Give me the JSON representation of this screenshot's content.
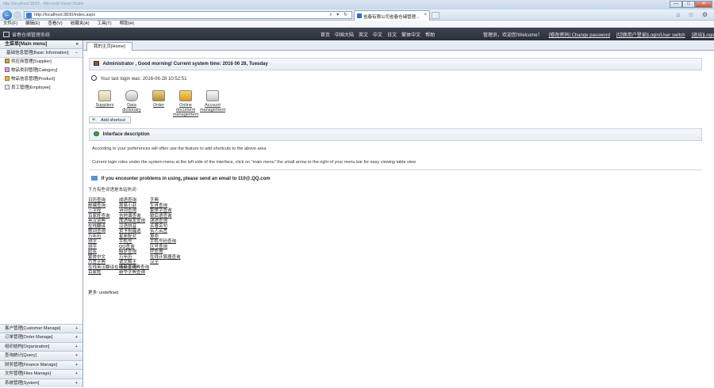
{
  "browser": {
    "url": "http://localhost:3830/index.aspx",
    "tab_title": "省春有限公司省春仓储管理...",
    "tab_close": "×",
    "address_controls": "⌕ ▾ ↻",
    "tools": "⌂ ☆ ⚙",
    "win_min": "—",
    "win_max": "□",
    "win_close": "✕"
  },
  "menubar": [
    "文件(F)",
    "编辑(E)",
    "查看(V)",
    "收藏夹(A)",
    "工具(T)",
    "帮助(H)"
  ],
  "app": {
    "title": "省春仓储管理系统",
    "links": [
      "首页",
      "中国大陆",
      "英文",
      "中文",
      "日文",
      "繁体中文",
      "帮助"
    ],
    "right_links": [
      {
        "label": "管理员，欢迎您!Welcome！",
        "underline": false
      },
      {
        "label": "[修改密码] Change password",
        "underline": true
      },
      {
        "label": "[切换用户登录]Login/User switch",
        "underline": true
      },
      {
        "label": "[退出]Logout",
        "underline": true
      }
    ]
  },
  "sidebar": {
    "main_menu": "主菜单[Main menu]",
    "main_toggle": "«",
    "basic_info": "基础信息管理[Basic Information]",
    "basic_toggle": "−",
    "items": [
      {
        "label": "供应商管理[Supplier]",
        "icon": "supplier-icon"
      },
      {
        "label": "物品类别管理[Category]",
        "icon": "category-icon"
      },
      {
        "label": "物品信息管理[Product]",
        "icon": "product-icon"
      },
      {
        "label": "员工管理[Employee]",
        "icon": "employee-icon"
      }
    ],
    "bottom": [
      {
        "label": "客户管理[Customer Manage]",
        "toggle": "+"
      },
      {
        "label": "订单管理[Order Manage]",
        "toggle": "+"
      },
      {
        "label": "组织结构[Organization]",
        "toggle": "+"
      },
      {
        "label": "查询统计[Query]",
        "toggle": "+"
      },
      {
        "label": "财务管理[Finance Manage]",
        "toggle": "+"
      },
      {
        "label": "文件管理[Files Manage]",
        "toggle": "+"
      },
      {
        "label": "系统管理[System]",
        "toggle": "+"
      }
    ]
  },
  "main": {
    "tab_label": "我的主页[Home]",
    "greeting": "Administrator , Good morning! Current system time: 2016 06 28, Tuesday",
    "last_login": "Your last login was: 2016-06-28 10:52:51",
    "shortcuts": [
      {
        "label": "Suppliers",
        "icon": "supplier-shortcut-icon"
      },
      {
        "label": "Data dictionary",
        "icon": "dictionary-shortcut-icon"
      },
      {
        "label": "Order",
        "icon": "order-shortcut-icon"
      },
      {
        "label": "Online document management",
        "icon": "document-shortcut-icon"
      },
      {
        "label": "Account management",
        "icon": "account-shortcut-icon"
      }
    ],
    "add_shortcut": "Add shortcut",
    "add_shortcut_plus": "+",
    "interface_title": "Interface description",
    "desc1": "According to your preferences will often use the feature to add shortcuts to the above area",
    "desc2": "Current login roles under the system menu at the left side of the interface, click on \"main menu\" the small arrow to the right of your menu bar for easy viewing table view",
    "contact": "If you encounter problems in using, please send an email to 110@.QQ.com",
    "tip": "下方有些词语是本站热词:",
    "words": [
      "日历查询",
      "成语查询",
      "字典",
      "邮编查询",
      "周易小卦",
      "生肖查询",
      "三字经",
      "诗词查询",
      "繁体字查询",
      "百家姓查询",
      "吉他谱查询",
      "歇后语查询",
      "英汉词典",
      "成语接龙查询",
      "谜语查询",
      "在线翻译",
      "汉语拼音",
      "名著名句",
      "歌词查询",
      "贺卡祝福语",
      "名人名言",
      "万年历",
      "星座配对",
      "算命",
      "测字",
      "手机号",
      "手机号码查询",
      "测字",
      "QQ查询",
      "区号查询",
      "起名",
      "解梦查询",
      "IP查询",
      "繁体中文",
      "万年历",
      "在线计算器查询",
      "方言字典",
      "说文解字",
      "汉字",
      "在线英汉翻译在线英汉词典查询",
      "诗经查询",
      "",
      "百家姓",
      "新华字典查询",
      ""
    ],
    "more_label": "更多: undefined"
  }
}
